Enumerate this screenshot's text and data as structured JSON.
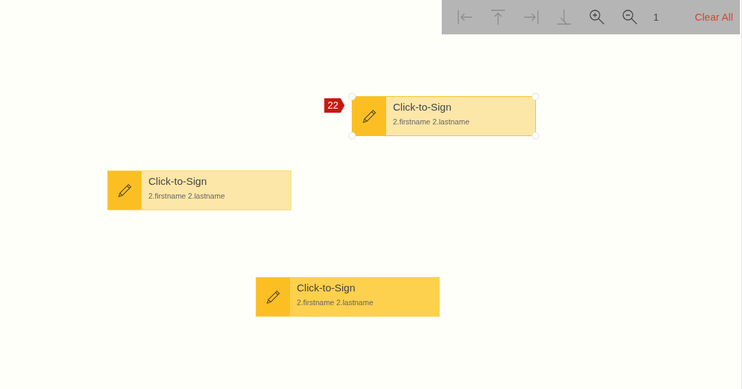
{
  "toolbar": {
    "tools": [
      {
        "kind": "align-left"
      },
      {
        "kind": "align-top"
      },
      {
        "kind": "align-right"
      },
      {
        "kind": "align-bottom"
      },
      {
        "kind": "zoom-in"
      },
      {
        "kind": "zoom-out"
      }
    ],
    "page": "1",
    "clear_button": "Clear All"
  },
  "fields": [
    {
      "title": "Click-to-Sign",
      "signer": "2.firstname 2.lastname",
      "selected": true,
      "highlighted": false,
      "badge": "22"
    },
    {
      "title": "Click-to-Sign",
      "signer": "2.firstname 2.lastname",
      "selected": false,
      "highlighted": false
    },
    {
      "title": "Click-to-Sign",
      "signer": "2.firstname 2.lastname",
      "selected": false,
      "highlighted": true
    }
  ]
}
